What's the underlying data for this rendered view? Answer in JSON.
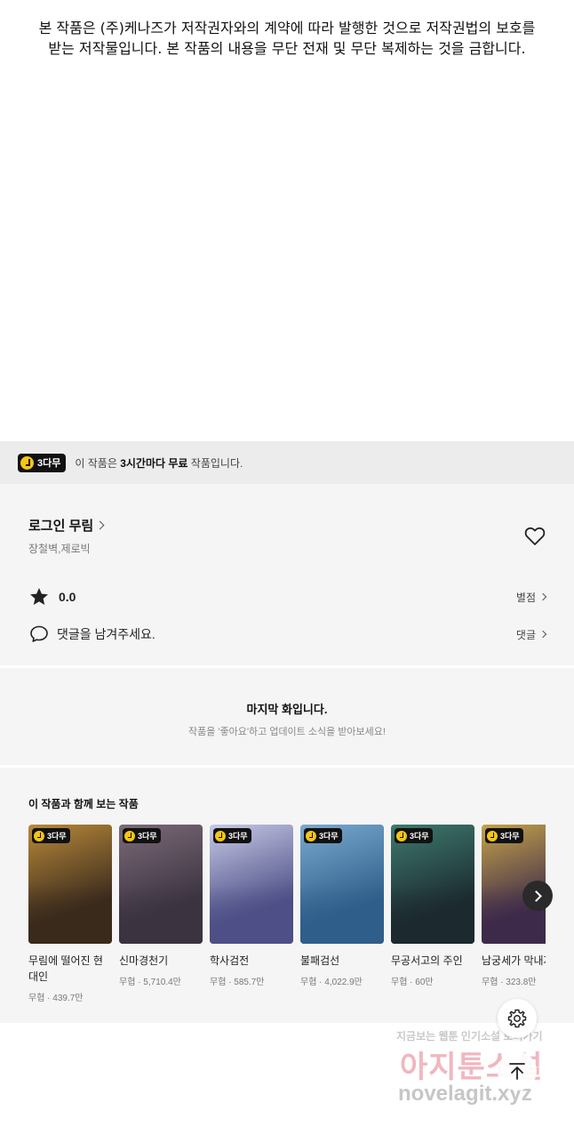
{
  "copyright": {
    "line1": "본 작품은 (주)케나즈가 저작권자와의 계약에 따라 발행한 것으로 저작권법의 보호를",
    "line2": "받는 저작물입니다. 본 작품의 내용을 무단 전재 및 무단 복제하는 것을 금합니다."
  },
  "free_bar": {
    "badge": "3다무",
    "text_pre": "이 작품은 ",
    "text_bold": "3시간마다 무료",
    "text_post": " 작품입니다."
  },
  "work": {
    "title": "로그인 무림",
    "authors": "장철벽,제로빅",
    "rating": "0.0",
    "rating_link": "별점",
    "comment_prompt": "댓글을 남겨주세요.",
    "comment_link": "댓글"
  },
  "last_episode": {
    "title": "마지막 화입니다.",
    "subtitle": "작품을 '좋아요'하고 업데이트 소식을 받아보세요!"
  },
  "recommendations": {
    "heading": "이 작품과 함께 보는 작품",
    "badge": "3다무",
    "items": [
      {
        "title": "무림에 떨어진 현대인",
        "meta": "무협 · 439.7만",
        "colors": [
          "#3a2a1c",
          "#b8893a"
        ]
      },
      {
        "title": "신마경천기",
        "meta": "무협 · 5,710.4만",
        "colors": [
          "#3b3340",
          "#7c6a78"
        ]
      },
      {
        "title": "학사검전",
        "meta": "무협 · 585.7만",
        "colors": [
          "#4d4f86",
          "#c7c9e6"
        ]
      },
      {
        "title": "불패검선",
        "meta": "무협 · 4,022.9만",
        "colors": [
          "#2f5e8a",
          "#7aa9cf"
        ]
      },
      {
        "title": "무공서고의 주인",
        "meta": "무협 · 60만",
        "colors": [
          "#1c2a30",
          "#3e7a6e"
        ]
      },
      {
        "title": "남궁세가 막내자",
        "meta": "무협 · 323.8만",
        "colors": [
          "#3d2a4a",
          "#c4a24a"
        ]
      }
    ]
  },
  "watermark": {
    "line1": "지금보는 웹툰 인기소설 보러가기",
    "line2": "아지툰소설",
    "line3": "novelagit.xyz"
  }
}
